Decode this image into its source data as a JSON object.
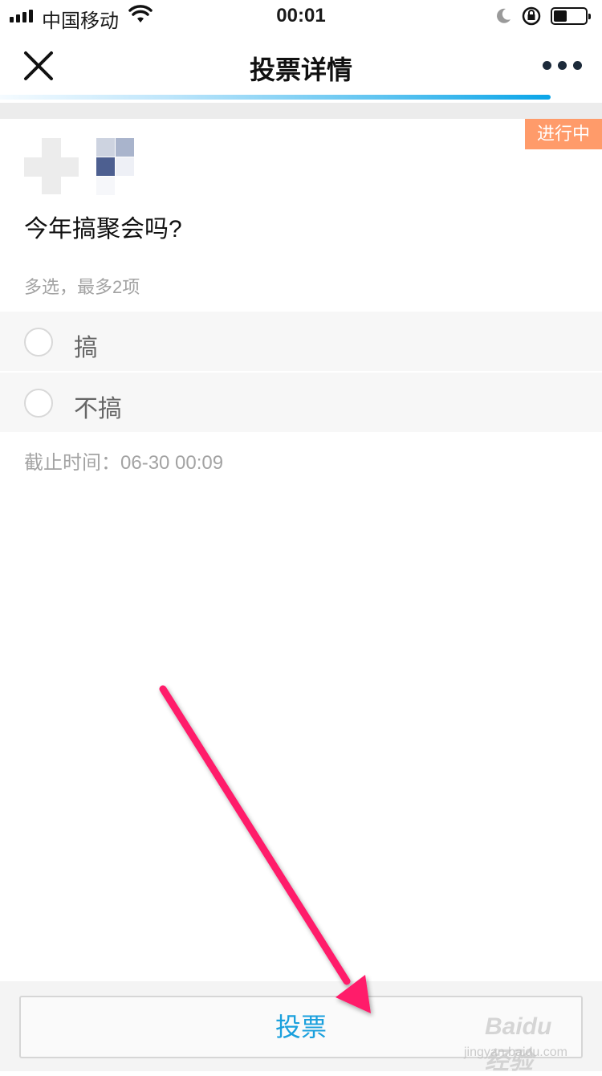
{
  "status_bar": {
    "carrier": "中国移动",
    "time": "00:01",
    "battery_level": 0.35
  },
  "nav": {
    "title": "投票详情"
  },
  "poll": {
    "status_tag": "进行中",
    "question": "今年搞聚会吗?",
    "hint": "多选，最多2项",
    "options": [
      {
        "label": "搞",
        "selected": false
      },
      {
        "label": "不搞",
        "selected": false
      }
    ],
    "deadline_label": "截止时间：",
    "deadline_value": "06-30 00:09"
  },
  "footer": {
    "vote_label": "投票"
  },
  "watermark": {
    "brand": "Baidu 经验",
    "url": "jingyan.baidu.com"
  },
  "colors": {
    "accent_blue": "#1aa0dd",
    "status_tag": "#ff9b6a",
    "arrow": "#ff1a6b"
  }
}
